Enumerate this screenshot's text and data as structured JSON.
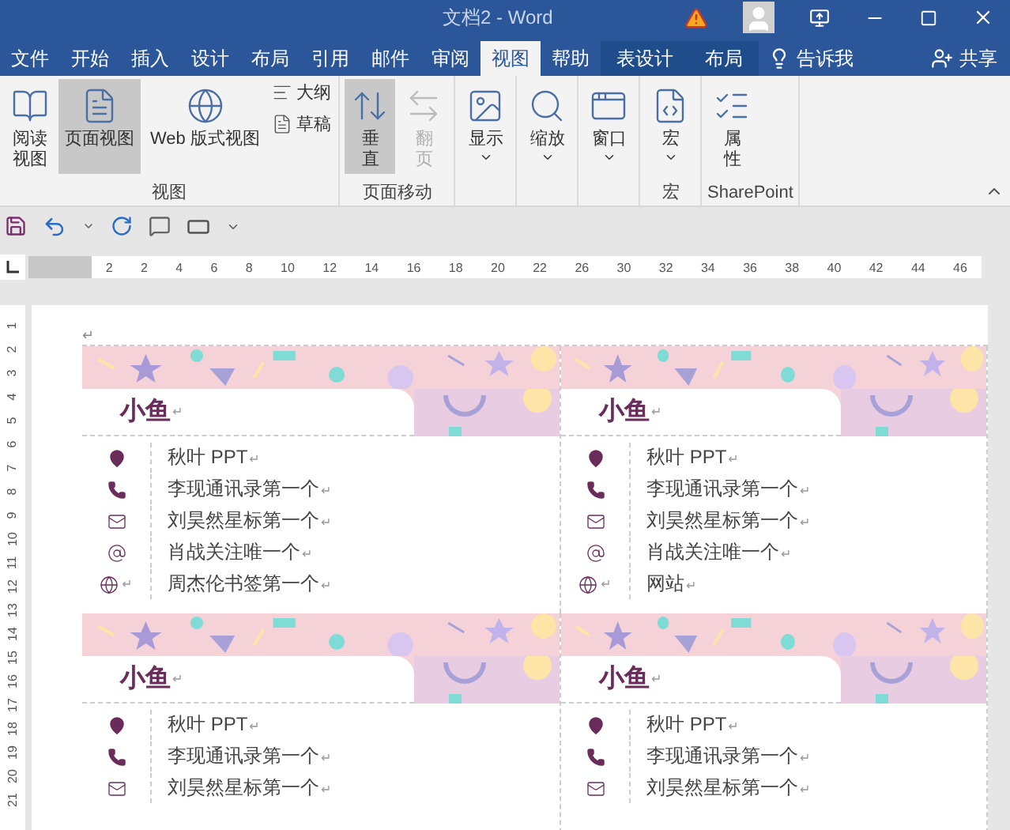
{
  "window": {
    "title": "文档2  -  Word"
  },
  "tabs": [
    {
      "label": "文件",
      "selected": false,
      "kind": "normal"
    },
    {
      "label": "开始",
      "selected": false,
      "kind": "normal"
    },
    {
      "label": "插入",
      "selected": false,
      "kind": "normal"
    },
    {
      "label": "设计",
      "selected": false,
      "kind": "normal"
    },
    {
      "label": "布局",
      "selected": false,
      "kind": "normal"
    },
    {
      "label": "引用",
      "selected": false,
      "kind": "normal"
    },
    {
      "label": "邮件",
      "selected": false,
      "kind": "normal"
    },
    {
      "label": "审阅",
      "selected": false,
      "kind": "normal"
    },
    {
      "label": "视图",
      "selected": true,
      "kind": "normal"
    },
    {
      "label": "帮助",
      "selected": false,
      "kind": "normal"
    },
    {
      "label": "表设计",
      "selected": false,
      "kind": "contextual"
    },
    {
      "label": "布局",
      "selected": false,
      "kind": "contextual"
    }
  ],
  "tell_me": {
    "label": "告诉我"
  },
  "share": {
    "label": "共享"
  },
  "ribbon": {
    "groups": [
      {
        "label": "视图",
        "items": [
          {
            "kind": "large",
            "lines": [
              "阅读",
              "视图"
            ],
            "selected": false,
            "disabled": false,
            "dropdown": false
          },
          {
            "kind": "large",
            "lines": [
              "页面视图"
            ],
            "selected": true,
            "disabled": false,
            "dropdown": false
          },
          {
            "kind": "large",
            "lines": [
              "Web 版式视图"
            ],
            "selected": false,
            "disabled": false,
            "dropdown": false
          },
          {
            "kind": "small",
            "lines": [
              "大纲"
            ],
            "selected": false,
            "disabled": false,
            "dropdown": false
          },
          {
            "kind": "small",
            "lines": [
              "草稿"
            ],
            "selected": false,
            "disabled": false,
            "dropdown": false
          }
        ]
      },
      {
        "label": "页面移动",
        "items": [
          {
            "kind": "large",
            "lines": [
              "垂",
              "直"
            ],
            "selected": true,
            "disabled": false,
            "dropdown": false
          },
          {
            "kind": "large",
            "lines": [
              "翻",
              "页"
            ],
            "selected": false,
            "disabled": true,
            "dropdown": false
          }
        ]
      },
      {
        "items": [
          {
            "kind": "large",
            "lines": [
              "显示"
            ],
            "selected": false,
            "disabled": false,
            "dropdown": true
          }
        ]
      },
      {
        "items": [
          {
            "kind": "large",
            "lines": [
              "缩放"
            ],
            "selected": false,
            "disabled": false,
            "dropdown": true
          }
        ]
      },
      {
        "items": [
          {
            "kind": "large",
            "lines": [
              "窗口"
            ],
            "selected": false,
            "disabled": false,
            "dropdown": true
          }
        ]
      },
      {
        "label": "宏",
        "items": [
          {
            "kind": "large",
            "lines": [
              "宏"
            ],
            "selected": false,
            "disabled": false,
            "dropdown": true
          }
        ]
      },
      {
        "label": "SharePoint",
        "items": [
          {
            "kind": "large",
            "lines": [
              "属",
              "性"
            ],
            "selected": false,
            "disabled": false,
            "dropdown": false
          }
        ]
      }
    ]
  },
  "ruler": {
    "labels": [
      "2",
      "2",
      "4",
      "6",
      "8",
      "10",
      "12",
      "14",
      "16",
      "18",
      "20",
      "22",
      "26",
      "30",
      "32",
      "34",
      "36",
      "38",
      "40",
      "42",
      "44",
      "46"
    ]
  },
  "vertical_ruler": {
    "labels": [
      "1",
      "2",
      "3",
      "4",
      "5",
      "6",
      "7",
      "8",
      "9",
      "10",
      "11",
      "12",
      "13",
      "14",
      "15",
      "16",
      "17",
      "18",
      "19",
      "20",
      "21"
    ]
  },
  "document": {
    "paragraph_mark": "↵",
    "cards": [
      {
        "name": "小鱼",
        "rows": [
          {
            "text": "秋叶 PPT",
            "icon_mark": false
          },
          {
            "text": "李现通讯录第一个",
            "icon_mark": false
          },
          {
            "text": "刘昊然星标第一个",
            "icon_mark": false
          },
          {
            "text": "肖战关注唯一个",
            "icon_mark": false
          },
          {
            "text": "周杰伦书签第一个",
            "icon_mark": true
          }
        ]
      },
      {
        "name": "小鱼",
        "rows": [
          {
            "text": "秋叶 PPT",
            "icon_mark": false
          },
          {
            "text": "李现通讯录第一个",
            "icon_mark": false
          },
          {
            "text": "刘昊然星标第一个",
            "icon_mark": false
          },
          {
            "text": "肖战关注唯一个",
            "icon_mark": false
          },
          {
            "text": "网站",
            "icon_mark": true
          }
        ]
      },
      {
        "name": "小鱼",
        "rows": [
          {
            "text": "秋叶 PPT",
            "icon_mark": false
          },
          {
            "text": "李现通讯录第一个",
            "icon_mark": false
          },
          {
            "text": "刘昊然星标第一个",
            "icon_mark": false
          }
        ]
      },
      {
        "name": "小鱼",
        "rows": [
          {
            "text": "秋叶 PPT",
            "icon_mark": false
          },
          {
            "text": "李现通讯录第一个",
            "icon_mark": false
          },
          {
            "text": "刘昊然星标第一个",
            "icon_mark": false
          }
        ]
      }
    ]
  }
}
